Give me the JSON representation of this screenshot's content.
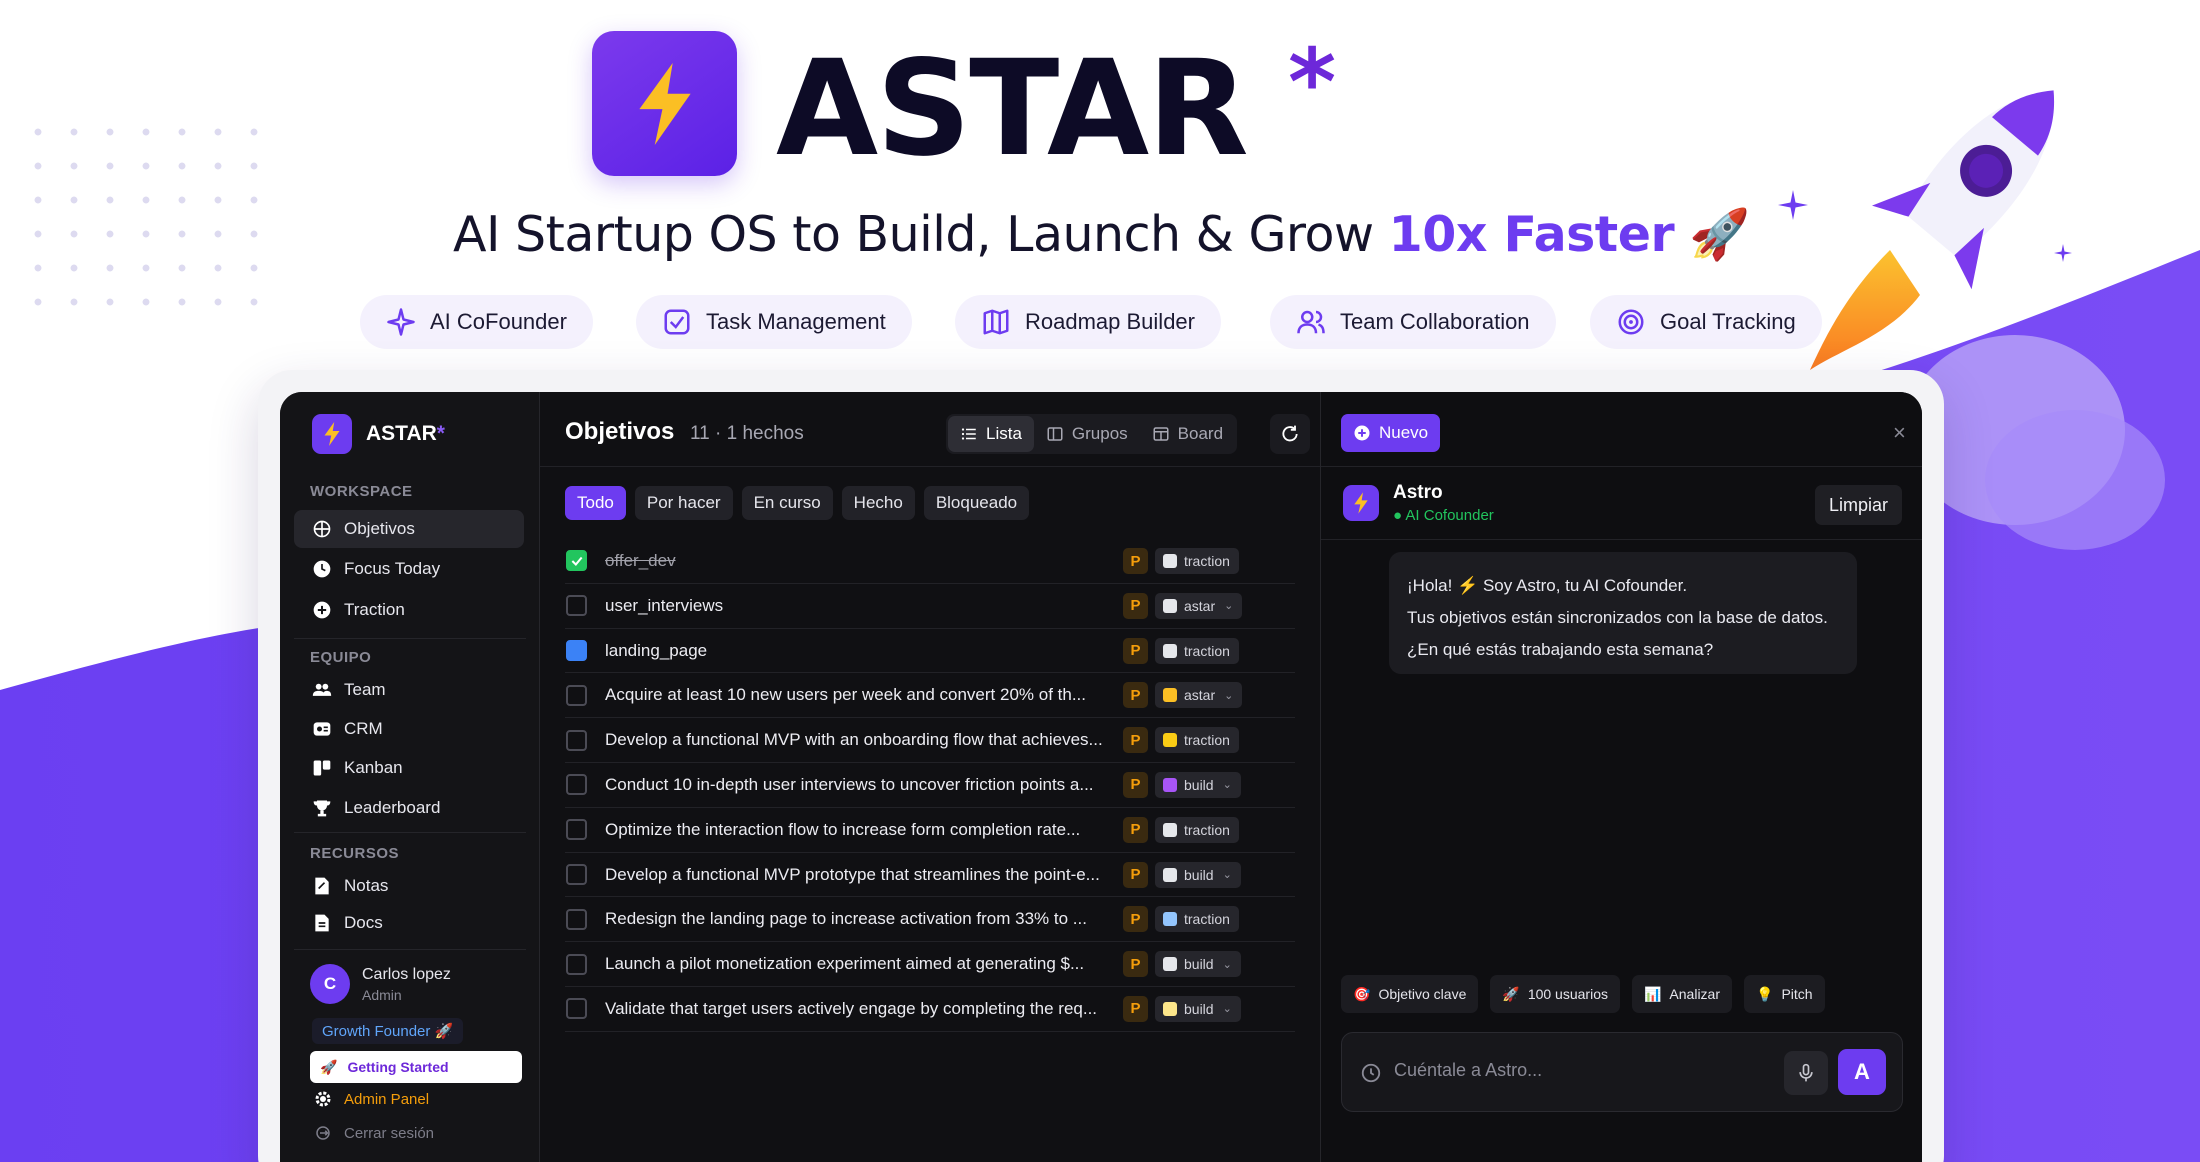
{
  "brand": {
    "name": "ASTAR",
    "star": "*",
    "tagline_main": "AI Startup OS to Build, Launch & Grow ",
    "tagline_highlight": "10x Faster",
    "tagline_emoji": "🚀",
    "accent": "#6d3cf0"
  },
  "features": [
    {
      "label": "AI CoFounder",
      "icon": "sparkle-icon"
    },
    {
      "label": "Task Management",
      "icon": "checkbox-icon"
    },
    {
      "label": "Roadmap Builder",
      "icon": "map-icon"
    },
    {
      "label": "Team Collaboration",
      "icon": "users-icon"
    },
    {
      "label": "Goal Tracking",
      "icon": "target-icon"
    }
  ],
  "sidebar": {
    "logo": "ASTAR",
    "logo_star": "*",
    "sections": {
      "workspace": "WORKSPACE",
      "equipo": "EQUIPO",
      "recursos": "RECURSOS"
    },
    "workspace_items": [
      {
        "label": "Objetivos",
        "icon": "crosshair-icon",
        "active": true
      },
      {
        "label": "Focus Today",
        "icon": "clock-icon"
      },
      {
        "label": "Traction",
        "icon": "plus-circle-icon"
      }
    ],
    "equipo_items": [
      {
        "label": "Team",
        "icon": "team-icon"
      },
      {
        "label": "CRM",
        "icon": "id-card-icon"
      },
      {
        "label": "Kanban",
        "icon": "kanban-icon"
      },
      {
        "label": "Leaderboard",
        "icon": "trophy-icon"
      }
    ],
    "recursos_items": [
      {
        "label": "Notas",
        "icon": "note-icon"
      },
      {
        "label": "Docs",
        "icon": "doc-icon"
      }
    ],
    "user": {
      "initial": "C",
      "name": "Carlos lopez",
      "role": "Admin"
    },
    "badge": "Growth Founder 🚀",
    "getting_started": "Getting Started",
    "admin_panel": "Admin Panel",
    "logout": "Cerrar sesión"
  },
  "main": {
    "title": "Objetivos",
    "count": "11 · 1 hechos",
    "views": [
      "Lista",
      "Grupos",
      "Board"
    ],
    "filters": [
      "Todo",
      "Por hacer",
      "En curso",
      "Hecho",
      "Bloqueado"
    ],
    "tasks": [
      {
        "text": "offer_dev",
        "state": "done",
        "priority": "P",
        "tag": "traction",
        "tag_color": "#e5e7eb",
        "dropdown": false
      },
      {
        "text": "user_interviews",
        "state": "todo",
        "priority": "P",
        "tag": "astar",
        "tag_color": "#e5e7eb",
        "dropdown": true
      },
      {
        "text": "landing_page",
        "state": "selected",
        "priority": "P",
        "tag": "traction",
        "tag_color": "#e5e7eb",
        "dropdown": false
      },
      {
        "text": "Acquire at least 10 new users per week and convert 20% of th...",
        "state": "todo",
        "priority": "P",
        "tag": "astar",
        "tag_color": "#fbbf24",
        "dropdown": true
      },
      {
        "text": "Develop a functional MVP with an onboarding flow that achieves...",
        "state": "todo",
        "priority": "P",
        "tag": "traction",
        "tag_color": "#facc15",
        "dropdown": false
      },
      {
        "text": "Conduct 10 in-depth user interviews to uncover friction points a...",
        "state": "todo",
        "priority": "P",
        "tag": "build",
        "tag_color": "#a855f7",
        "dropdown": true
      },
      {
        "text": "Optimize the interaction flow to increase form completion rate...",
        "state": "todo",
        "priority": "P",
        "tag": "traction",
        "tag_color": "#e5e7eb",
        "dropdown": false
      },
      {
        "text": "Develop a functional MVP prototype that streamlines the point-e...",
        "state": "todo",
        "priority": "P",
        "tag": "build",
        "tag_color": "#e5e7eb",
        "dropdown": true
      },
      {
        "text": "Redesign the landing page to increase activation from 33% to ...",
        "state": "todo",
        "priority": "P",
        "tag": "traction",
        "tag_color": "#93c5fd",
        "dropdown": false
      },
      {
        "text": "Launch a pilot monetization experiment aimed at generating $...",
        "state": "todo",
        "priority": "P",
        "tag": "build",
        "tag_color": "#e5e7eb",
        "dropdown": true
      },
      {
        "text": "Validate that target users actively engage by completing the req...",
        "state": "todo",
        "priority": "P",
        "tag": "build",
        "tag_color": "#fde68a",
        "dropdown": true
      }
    ]
  },
  "chat": {
    "new_label": "Nuevo",
    "close": "×",
    "assistant_name": "Astro",
    "assistant_sub": "● AI Cofounder",
    "clear_label": "Limpiar",
    "message_lines": [
      "¡Hola! ⚡ Soy Astro, tu AI Cofounder.",
      "Tus objetivos están sincronizados con la base de datos.",
      "¿En qué estás trabajando esta semana?"
    ],
    "suggestions": [
      {
        "emoji": "🎯",
        "label": "Objetivo clave"
      },
      {
        "emoji": "🚀",
        "label": "100 usuarios"
      },
      {
        "emoji": "📊",
        "label": "Analizar"
      },
      {
        "emoji": "💡",
        "label": "Pitch"
      }
    ],
    "placeholder": "Cuéntale a Astro...",
    "send_label": "A"
  }
}
